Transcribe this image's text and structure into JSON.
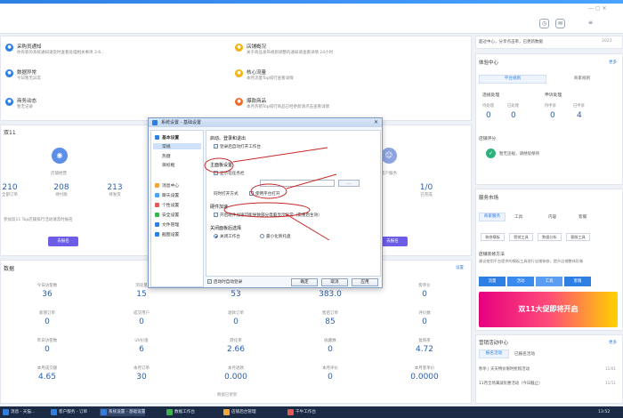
{
  "notices_left": [
    {
      "title": "采购员通知",
      "desc": "你有新的系统通知请及时查看处理相关事项 3-6...",
      "color": "#2e7fe4"
    },
    {
      "title": "数据异常",
      "desc": "今日暂无异常",
      "color": "#2e7fe4"
    },
    {
      "title": "商务动态",
      "desc": "暂无记录",
      "color": "#2e7fe4"
    }
  ],
  "notices_right": [
    {
      "title": "店铺概况",
      "desc": "关于商品发布规则调整的通知请查看详情 24小时",
      "color": "#f2b311"
    },
    {
      "title": "核心流量",
      "desc": "本月流量Top排行查看详情",
      "color": "#f2b311"
    },
    {
      "title": "爆款商品",
      "desc": "本月热销Top排行商品已经更新请点击查看详情",
      "color": "#ef6b2c"
    }
  ],
  "section1": {
    "title": "双11",
    "stats": [
      {
        "value": "210",
        "label": "全部订单"
      },
      {
        "value": "208",
        "label": "待付款"
      },
      {
        "value": "213",
        "label": "待发货"
      },
      {
        "value": "1/0",
        "label": "已完成"
      }
    ],
    "note": "参加双11 Top店铺排行活动请及时报名",
    "btn_left": "去报名",
    "btn_right": "去报名",
    "center_label": "店铺经营",
    "right_label": "客户服务"
  },
  "section2": {
    "title": "数据",
    "link": "设置",
    "items": [
      {
        "label": "今日访客数",
        "value": "36"
      },
      {
        "label": "浏览量",
        "value": "15"
      },
      {
        "label": "支付订单",
        "value": "53"
      },
      {
        "label": "支付金额",
        "value": "383.0"
      },
      {
        "label": "客单价",
        "value": "0"
      },
      {
        "label": "新增订单",
        "value": "0"
      },
      {
        "label": "成交用户",
        "value": "0"
      },
      {
        "label": "退款订单",
        "value": "0"
      },
      {
        "label": "售后订单",
        "value": "85"
      },
      {
        "label": "评价数",
        "value": "0"
      },
      {
        "label": "昨日访客数",
        "value": "0"
      },
      {
        "label": "UV价值",
        "value": "6"
      },
      {
        "label": "转化率",
        "value": "2.66"
      },
      {
        "label": "收藏数",
        "value": "0"
      },
      {
        "label": "复购率",
        "value": "4.72"
      },
      {
        "label": "本月成交额",
        "value": "4.65"
      },
      {
        "label": "本月订单",
        "value": "30"
      },
      {
        "label": "本月退款",
        "value": "0.000"
      },
      {
        "label": "本月评价",
        "value": "0"
      },
      {
        "label": "本月客单价",
        "value": "0.0000"
      }
    ],
    "footer": "数据已更新"
  },
  "right_panel": {
    "top_note": "超过中心，分享点击率，已更新数据",
    "top_date": "2023",
    "exp_title": "体验中心",
    "exp_link": "更多",
    "exp_tabs": [
      "平台规则",
      "商家规则"
    ],
    "exp_cols": [
      {
        "head": "违规处理",
        "items": [
          {
            "label": "待处理",
            "value": "0"
          },
          {
            "label": "已处理",
            "value": "0"
          }
        ]
      },
      {
        "head": "申诉处理",
        "items": [
          {
            "label": "待申诉",
            "value": "0"
          },
          {
            "label": "已申诉",
            "value": "4"
          }
        ]
      }
    ],
    "score_label": "店铺评分",
    "score_text": "暂无违规，请继续保持",
    "svc_title": "服务市场",
    "svc_tabs": [
      "商家服务",
      "工具",
      "内容",
      "客服"
    ],
    "svc_tags": [
      "装修模板",
      "营销工具",
      "数据分析",
      "客服工具"
    ],
    "svc_note_title": "店铺装修方法",
    "svc_note": "建议使用平台提供的模板工具进行店铺装修，提升店铺整体形象",
    "svc_chips": [
      "流量",
      "活动",
      "工具",
      "客服"
    ],
    "banner": "双11大促即将开启",
    "mkt_title": "营销活动中心",
    "mkt_link": "更多",
    "mkt_tabs": [
      "报名活动",
      "已报名活动"
    ],
    "mkt_items": [
      {
        "text": "秒杀 | 天天特价限时抢购活动",
        "date": "11/01"
      },
      {
        "text": "11月全场满减优惠活动（今日截止）",
        "date": "11/11"
      }
    ]
  },
  "dialog": {
    "title": "系统设置 - 基础设置",
    "side_items": [
      {
        "label": "基本设置",
        "color": "#2e7fe4"
      },
      {
        "label": "常规",
        "color": "#ffffff"
      },
      {
        "label": "热键",
        "color": "#ffffff"
      },
      {
        "label": "目标框",
        "color": "#ffffff"
      },
      {
        "label": "消息中心",
        "color": "#f2a53a"
      },
      {
        "label": "聊天设置",
        "color": "#4aa3ff"
      },
      {
        "label": "个性设置",
        "color": "#e05a5a"
      },
      {
        "label": "安全设置",
        "color": "#3bb54a"
      },
      {
        "label": "文件管理",
        "color": "#2e7fe4"
      },
      {
        "label": "截图设置",
        "color": "#2e7fe4"
      }
    ],
    "sec_startup": "启动、登录和退出",
    "opt_startup": "登录后自动打开工作台",
    "sec_main": "主面板设置",
    "opt_main": "显示在任务栏",
    "field_label": "同时打开方式",
    "opt_field": "使用平台打开",
    "sec_speed": "硬件加速",
    "opt_speed": "开启硬件加速可能导致部分电脑显示异常（需重启生效）",
    "sec_close": "关闭面板后选择",
    "radio1": "关闭工作台",
    "radio2": "最小化到托盘",
    "footer_cb": "启动时自动登录",
    "btn_ok": "确定",
    "btn_cancel": "取消",
    "btn_apply": "应用"
  },
  "taskbar": [
    {
      "label": "消息 - 天猫...",
      "color": "#2e7fe4"
    },
    {
      "label": "客户服务 - 订单",
      "color": "#2e7fe4"
    },
    {
      "label": "系统设置 - 基础设置",
      "color": "#2e7fe4"
    },
    {
      "label": "数据工作台",
      "color": "#3bb54a"
    },
    {
      "label": "店铺后台管理",
      "color": "#f2a53a"
    },
    {
      "label": "千牛工作台",
      "color": "#e05a5a"
    }
  ],
  "clock": "13:52"
}
